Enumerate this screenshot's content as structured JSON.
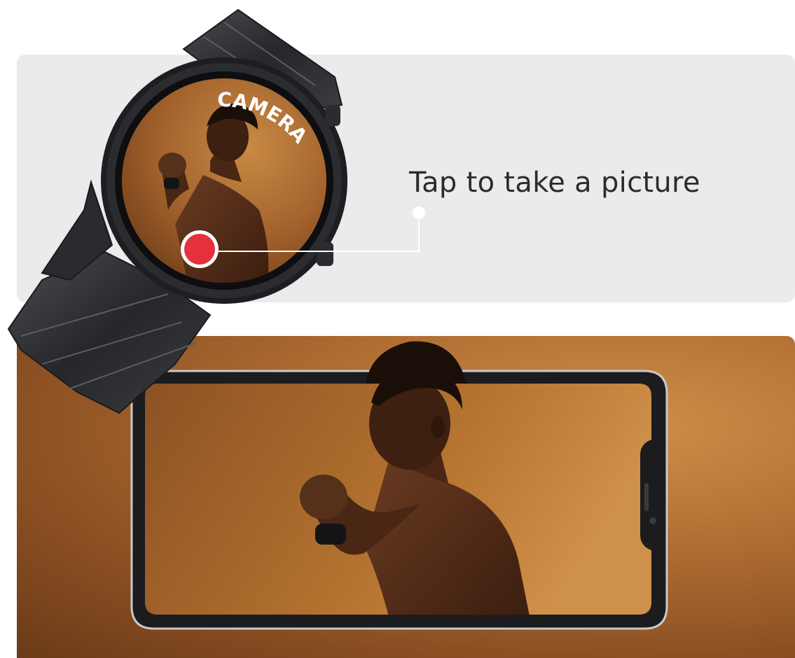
{
  "watch": {
    "app_label": "CAMERA",
    "shutter_color": "#e6303b"
  },
  "callout": {
    "text": "Tap to take a picture"
  },
  "colors": {
    "panel_background": "#ebebeb",
    "backdrop_orange": "#b06d32",
    "text_dark": "#2c2c2c"
  }
}
